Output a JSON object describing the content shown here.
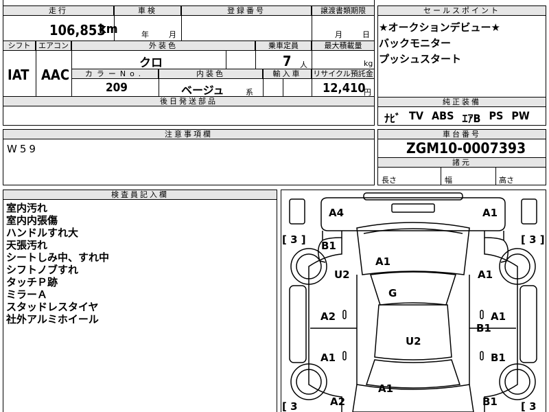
{
  "top_header": {
    "mileage_label": "走行",
    "inspection_label": "車検",
    "registration_label": "登録番号",
    "transfer_doc_label": "譲渡書類期限"
  },
  "mileage": {
    "value": "106,853",
    "unit": "km"
  },
  "inspection": {
    "year_label": "年",
    "month_label": "月"
  },
  "transfer_doc": {
    "month_label": "月",
    "day_label": "日"
  },
  "row2": {
    "shift_label": "シフト",
    "ac_label": "エアコン",
    "exterior_color_label": "外装色",
    "capacity_label": "乗車定員",
    "max_load_label": "最大積載量"
  },
  "shift": "IAT",
  "ac": "AAC",
  "exterior_color": "クロ",
  "capacity": {
    "value": "7",
    "unit": "人"
  },
  "max_load": {
    "unit": "kg"
  },
  "row3": {
    "color_no_label": "カラーNo.",
    "interior_color_label": "内装色",
    "import_label": "輸入車",
    "recycle_label": "リサイクル預託金"
  },
  "color_no": "209",
  "interior_color": {
    "value": "ベージュ",
    "suffix": "系"
  },
  "recycle_fee": {
    "value": "12,410",
    "unit": "円"
  },
  "later_parts_label": "後日発送部品",
  "sales_points": {
    "label": "セールスポイント",
    "lines": [
      "★オークションデビュー★",
      "バックモニター",
      "プッシュスタート"
    ]
  },
  "equipment": {
    "label": "純正装備",
    "items": [
      "ﾅﾋﾞ",
      "TV",
      "ABS",
      "ｴｱB",
      "PS",
      "PW"
    ]
  },
  "notes": {
    "label": "注意事項欄",
    "text": "W59"
  },
  "chassis": {
    "label": "車台番号",
    "value": "ZGM10-0007393"
  },
  "dimensions": {
    "label": "諸元",
    "length_label": "長さ",
    "width_label": "幅",
    "height_label": "高さ"
  },
  "inspector": {
    "label": "検査員記入欄",
    "lines": [
      "室内汚れ",
      "室内内張傷",
      "ハンドルすれ大",
      "天張汚れ",
      "シートしみ中、すれ中",
      "シフトノブすれ",
      "タッチＰ跡",
      "ミラーＡ",
      "スタッドレスタイヤ",
      "社外アルミホイール"
    ]
  },
  "diagram": {
    "marks": {
      "front_left": "A4",
      "front_right": "A1",
      "hood": "A1",
      "left_front_fender": "B1",
      "left_front_door_upper": "U2",
      "right_front_fender": "A1",
      "roof": "G",
      "left_front_door": "A2",
      "right_front_door": "A1",
      "right_front_door_b": "B1",
      "interior": "U2",
      "left_rear_door": "A1",
      "right_rear_door": "B1",
      "trunk": "A1",
      "rear_left": "A2",
      "rear_right": "B1"
    },
    "tire_counts": {
      "front_left": "[ 3 ]",
      "front_right": "[ 3 ]",
      "rear_left": "[ 3",
      "rear_right": "[ 3"
    }
  }
}
